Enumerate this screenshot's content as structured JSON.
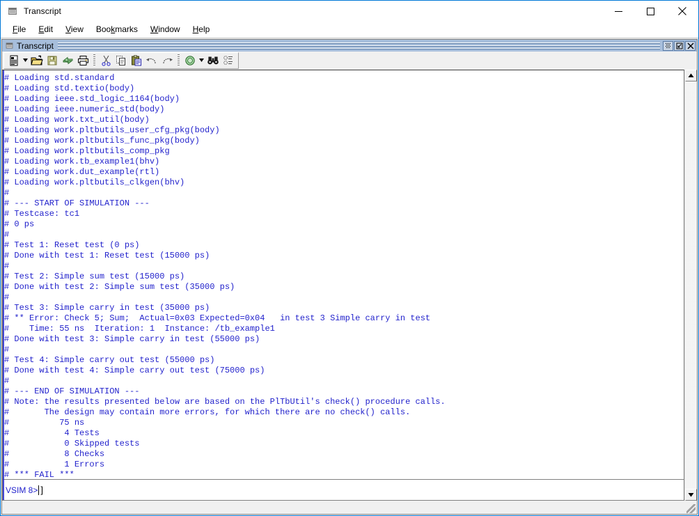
{
  "window": {
    "title": "Transcript",
    "icon": "modelsim-icon",
    "caption_buttons": [
      {
        "name": "minimize-button",
        "glyph": "minimize-icon"
      },
      {
        "name": "maximize-button",
        "glyph": "maximize-icon"
      },
      {
        "name": "close-button",
        "glyph": "close-icon"
      }
    ]
  },
  "menubar": {
    "items": [
      {
        "label": "File",
        "accel": "F"
      },
      {
        "label": "Edit",
        "accel": "E"
      },
      {
        "label": "View",
        "accel": "V"
      },
      {
        "label": "Bookmarks",
        "accel": "k"
      },
      {
        "label": "Window",
        "accel": "W"
      },
      {
        "label": "Help",
        "accel": "H"
      }
    ]
  },
  "child_window": {
    "title": "Transcript",
    "icon": "modelsim-icon",
    "buttons": [
      {
        "name": "undock-button",
        "glyph": "undock-icon"
      },
      {
        "name": "restore-button",
        "glyph": "restore-icon"
      },
      {
        "name": "close-child-button",
        "glyph": "close-icon"
      }
    ]
  },
  "toolbar": {
    "buttons": [
      {
        "name": "new-file-button",
        "icon": "new-document-icon",
        "tooltip": "New"
      },
      {
        "name": "new-file-dropdown",
        "icon": "chevron-down-icon",
        "tooltip": "New menu"
      },
      {
        "name": "open-file-button",
        "icon": "open-folder-icon",
        "tooltip": "Open"
      },
      {
        "name": "save-file-button",
        "icon": "save-floppy-icon",
        "tooltip": "Save"
      },
      {
        "name": "reload-button",
        "icon": "reload-arrows-icon",
        "tooltip": "Reload"
      },
      {
        "name": "print-button",
        "icon": "printer-icon",
        "tooltip": "Print"
      },
      {
        "name": "cut-button",
        "icon": "scissors-icon",
        "tooltip": "Cut"
      },
      {
        "name": "copy-button",
        "icon": "copy-pages-icon",
        "tooltip": "Copy"
      },
      {
        "name": "paste-button",
        "icon": "clipboard-paste-icon",
        "tooltip": "Paste"
      },
      {
        "name": "undo-button",
        "icon": "undo-arrow-icon",
        "tooltip": "Undo"
      },
      {
        "name": "redo-button",
        "icon": "redo-arrow-icon",
        "tooltip": "Redo"
      },
      {
        "name": "simulate-button",
        "icon": "green-circle-icon",
        "tooltip": "Simulate"
      },
      {
        "name": "simulate-dropdown",
        "icon": "chevron-down-icon",
        "tooltip": "Simulate menu"
      },
      {
        "name": "find-button",
        "icon": "binoculars-icon",
        "tooltip": "Find"
      },
      {
        "name": "goto-button",
        "icon": "goto-line-icon",
        "tooltip": "Go to"
      }
    ]
  },
  "transcript": {
    "lines": [
      "# Loading std.standard",
      "# Loading std.textio(body)",
      "# Loading ieee.std_logic_1164(body)",
      "# Loading ieee.numeric_std(body)",
      "# Loading work.txt_util(body)",
      "# Loading work.pltbutils_user_cfg_pkg(body)",
      "# Loading work.pltbutils_func_pkg(body)",
      "# Loading work.pltbutils_comp_pkg",
      "# Loading work.tb_example1(bhv)",
      "# Loading work.dut_example(rtl)",
      "# Loading work.pltbutils_clkgen(bhv)",
      "#",
      "# --- START OF SIMULATION ---",
      "# Testcase: tc1",
      "# 0 ps",
      "#",
      "# Test 1: Reset test (0 ps)",
      "# Done with test 1: Reset test (15000 ps)",
      "#",
      "# Test 2: Simple sum test (15000 ps)",
      "# Done with test 2: Simple sum test (35000 ps)",
      "#",
      "# Test 3: Simple carry in test (35000 ps)",
      "# ** Error: Check 5; Sum;  Actual=0x03 Expected=0x04   in test 3 Simple carry in test",
      "#    Time: 55 ns  Iteration: 1  Instance: /tb_example1",
      "# Done with test 3: Simple carry in test (55000 ps)",
      "#",
      "# Test 4: Simple carry out test (55000 ps)",
      "# Done with test 4: Simple carry out test (75000 ps)",
      "#",
      "# --- END OF SIMULATION ---",
      "# Note: the results presented below are based on the PlTbUtil's check() procedure calls.",
      "#       The design may contain more errors, for which there are no check() calls.",
      "#          75 ns",
      "#           4 Tests",
      "#           0 Skipped tests",
      "#           8 Checks",
      "#           1 Errors",
      "# *** FAIL ***"
    ],
    "summary": {
      "time": "75 ns",
      "tests": 4,
      "skipped_tests": 0,
      "checks": 8,
      "errors": 1,
      "result": "*** FAIL ***"
    },
    "text_color": "#2222cc"
  },
  "prompt": {
    "label": "VSIM 8>",
    "value": "",
    "placeholder": ""
  },
  "scrollbars": {
    "vertical_up": "scroll-up-icon",
    "vertical_down": "scroll-down-icon",
    "horizontal_left": "scroll-left-icon",
    "horizontal_right": "scroll-right-icon"
  },
  "colors": {
    "frame_accent": "#0078d7",
    "child_titlebar": "#a7bedb",
    "text_blue": "#2222cc",
    "chrome": "#f0f0f0"
  }
}
